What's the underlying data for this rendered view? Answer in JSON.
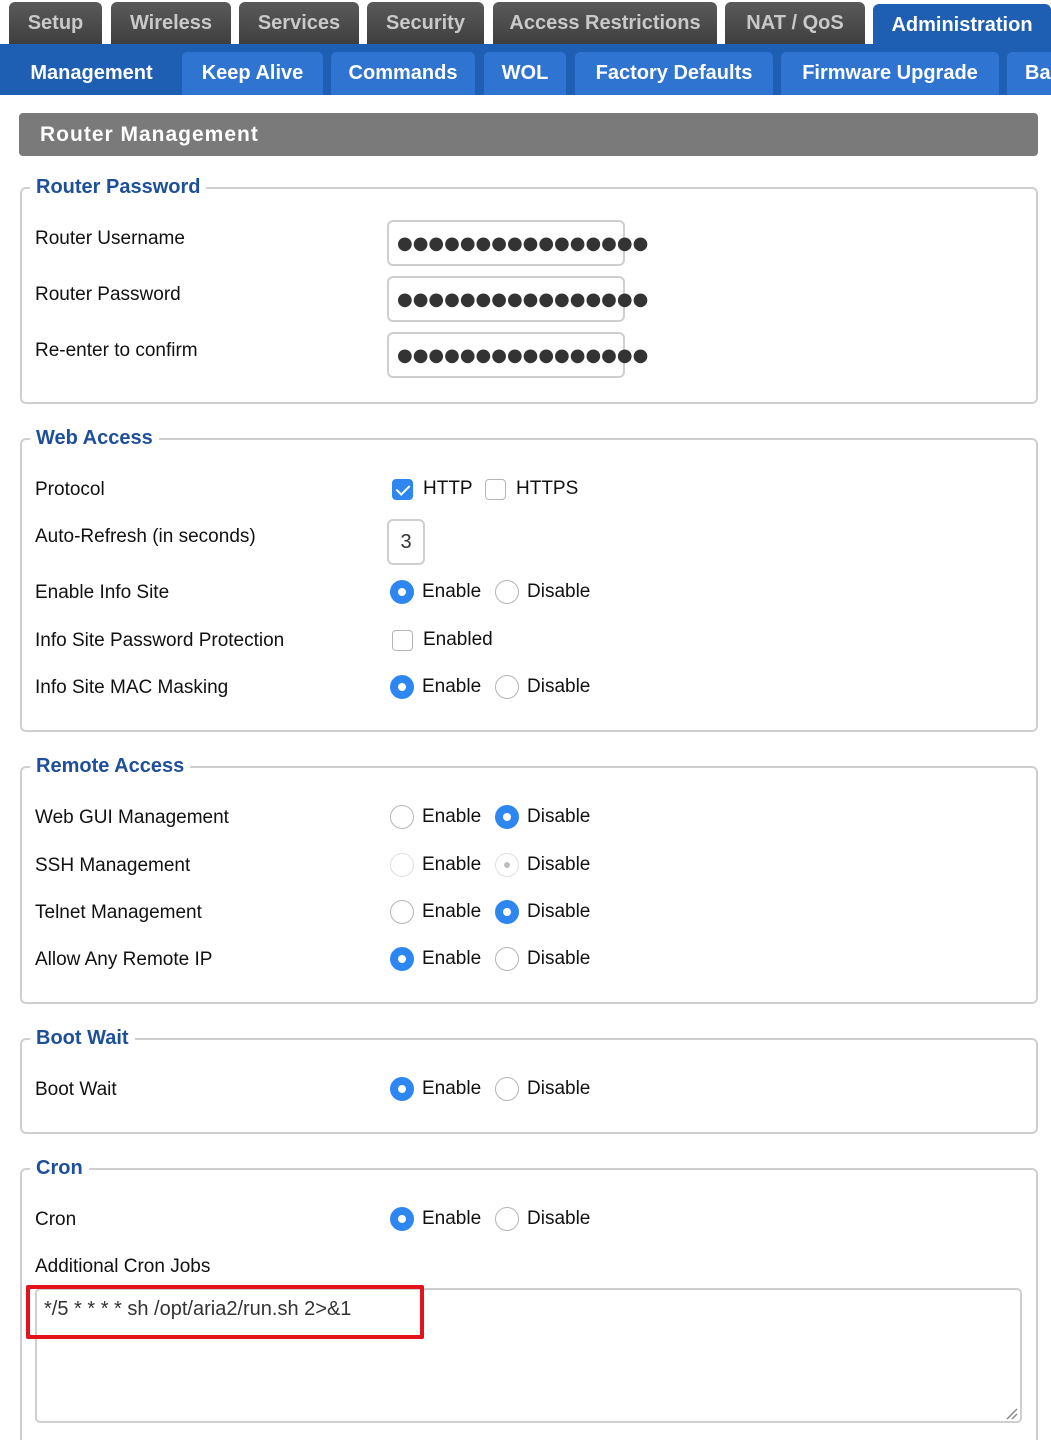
{
  "top_tabs": [
    "Setup",
    "Wireless",
    "Services",
    "Security",
    "Access Restrictions",
    "NAT / QoS",
    "Administration"
  ],
  "sub_tabs": [
    "Management",
    "Keep Alive",
    "Commands",
    "WOL",
    "Factory Defaults",
    "Firmware Upgrade",
    "Ba"
  ],
  "page_title": "Router Management",
  "router_password": {
    "legend": "Router Password",
    "username_label": "Router Username",
    "password_label": "Router Password",
    "confirm_label": "Re-enter to confirm",
    "username_value": "●●●●●●●●●●●●●●●●",
    "password_value": "●●●●●●●●●●●●●●●●",
    "confirm_value": "●●●●●●●●●●●●●●●●"
  },
  "web_access": {
    "legend": "Web Access",
    "protocol_label": "Protocol",
    "http": "HTTP",
    "https": "HTTPS",
    "auto_refresh_label": "Auto-Refresh (in seconds)",
    "auto_refresh_value": "3",
    "info_site_label": "Enable Info Site",
    "info_pw_label": "Info Site Password Protection",
    "info_pw_option": "Enabled",
    "mac_mask_label": "Info Site MAC Masking"
  },
  "remote_access": {
    "legend": "Remote Access",
    "web_gui_label": "Web GUI Management",
    "ssh_label": "SSH Management",
    "telnet_label": "Telnet Management",
    "any_ip_label": "Allow Any Remote IP"
  },
  "boot_wait": {
    "legend": "Boot Wait",
    "label": "Boot Wait"
  },
  "cron": {
    "legend": "Cron",
    "label": "Cron",
    "jobs_label": "Additional Cron Jobs",
    "jobs_value": "*/5 * * * * sh /opt/aria2/run.sh 2>&1"
  },
  "options": {
    "enable": "Enable",
    "disable": "Disable"
  },
  "colors": {
    "active_tab": "#1e5fb4",
    "radio_on": "#2e86f0",
    "highlight": "#e3121b"
  }
}
